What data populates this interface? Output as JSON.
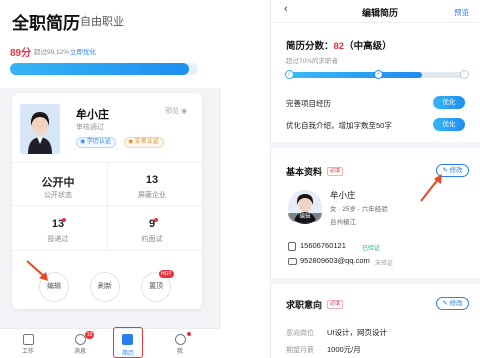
{
  "left": {
    "title": "全职简历",
    "subtitle": "自由职业",
    "score": "89分",
    "score_desc": "超过99.12%",
    "score_link": "立即优化",
    "progress": 0.95,
    "card": {
      "name": "牟小庄",
      "status": "审核通过",
      "preview": "预览",
      "badges": [
        "学历认证",
        "实名认证"
      ],
      "stats": [
        {
          "value": "公开中",
          "label": "公开状态"
        },
        {
          "value": "13",
          "label": "屏蔽企业"
        },
        {
          "value": "13",
          "label": "投递过"
        },
        {
          "value": "9",
          "label": "约面试"
        }
      ],
      "actions": [
        "编辑",
        "刷新",
        "置顶"
      ],
      "hot_badge": "HOT"
    },
    "tabbar": [
      {
        "label": "工作",
        "icon": "briefcase-icon"
      },
      {
        "label": "消息",
        "icon": "message-icon",
        "badge": "10"
      },
      {
        "label": "简历",
        "icon": "resume-icon"
      },
      {
        "label": "我",
        "icon": "person-icon"
      }
    ]
  },
  "right": {
    "nav": {
      "back": "‹",
      "title": "编辑简历",
      "preview": "预览"
    },
    "score_label": "简历分数：",
    "score_value": "82",
    "score_level": "（中高级）",
    "score_desc": "超过70%的求职者",
    "progress": 0.76,
    "tips": [
      {
        "text": "完善项目经历",
        "button": "优化"
      },
      {
        "text": "优化自我介绍，增加字数至50字",
        "button": "优化"
      }
    ],
    "basic": {
      "title": "基本资料",
      "required": "必填",
      "edit": "修改",
      "name": "牟小庄",
      "info": "女 · 25岁 · 六年经验",
      "city": "台州椒江",
      "avatar_tag": "编辑",
      "phone": "15606760121",
      "phone_status": "已验证",
      "email": "952809603@qq.com",
      "email_status": "未验证"
    },
    "intent": {
      "title": "求职意向",
      "required": "必填",
      "edit": "修改",
      "rows": [
        {
          "label": "意向岗位",
          "value": "UI设计，网页设计"
        },
        {
          "label": "期望月薪",
          "value": "1000元/月"
        }
      ]
    }
  },
  "colors": {
    "accent": "#2a7ef0",
    "red": "#e8343f",
    "verified": "#2fb36a"
  }
}
